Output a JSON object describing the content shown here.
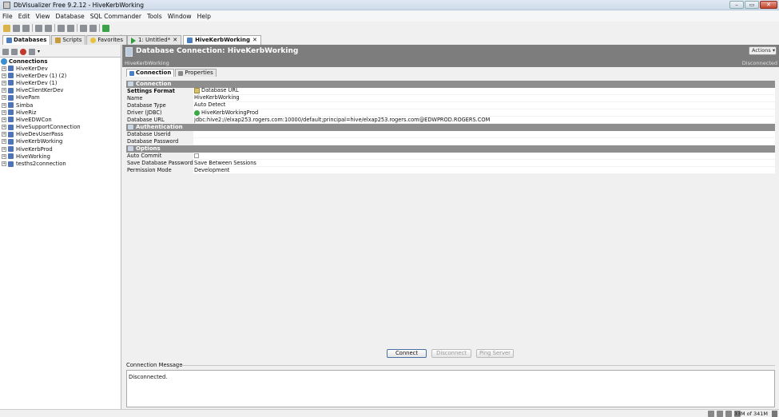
{
  "window": {
    "title": "DbVisualizer Free 9.2.12 - HiveKerbWorking"
  },
  "menu": [
    "File",
    "Edit",
    "View",
    "Database",
    "SQL Commander",
    "Tools",
    "Window",
    "Help"
  ],
  "left_tabs": [
    "Databases",
    "Scripts",
    "Favorites"
  ],
  "tree": {
    "root": "Connections",
    "items": [
      "HiveKerDev",
      "HiveKerDev (1) (2)",
      "HiveKerDev (1)",
      "HiveClientKerDev",
      "HivePam",
      "Simba",
      "HiveRiz",
      "HiveEDWCon",
      "HiveSupportConnection",
      "HiveDevUserPass",
      "HiveKerbWorking",
      "HiveKerbProd",
      "HiveWorking",
      "tesths2connection"
    ]
  },
  "doc_tabs": [
    "1: Untitled*",
    "HiveKerbWorking"
  ],
  "header": {
    "title": "Database Connection: HiveKerbWorking",
    "subtitle": "HiveKerbWorking",
    "actions": "Actions",
    "status": "Disconnected"
  },
  "sub_tabs": [
    "Connection",
    "Properties"
  ],
  "sections": {
    "connection": "Connection",
    "authentication": "Authentication",
    "options": "Options"
  },
  "fields": {
    "settings_format_label": "Settings Format",
    "settings_format_value": "Database URL",
    "name_label": "Name",
    "name_value": "HiveKerbWorking",
    "database_type_label": "Database Type",
    "database_type_value": "Auto Detect",
    "driver_label": "Driver (JDBC)",
    "driver_value": "HiveKerbWorkingProd",
    "database_url_label": "Database URL",
    "database_url_value": "jdbc:hive2://elxap253.rogers.com:10000/default;principal=hive/elxap253.rogers.com@EDWPROD.ROGERS.COM",
    "userid_label": "Database Userid",
    "userid_value": "",
    "password_label": "Database Password",
    "password_value": "",
    "autocommit_label": "Auto Commit",
    "save_password_label": "Save Database Password",
    "save_password_value": "Save Between Sessions",
    "permission_label": "Permission Mode",
    "permission_value": "Development"
  },
  "buttons": {
    "connect": "Connect",
    "disconnect": "Disconnect",
    "ping": "Ping Server"
  },
  "message": {
    "label": "Connection Message",
    "text": "Disconnected."
  },
  "status_bar": {
    "memory": "33M of 341M"
  }
}
